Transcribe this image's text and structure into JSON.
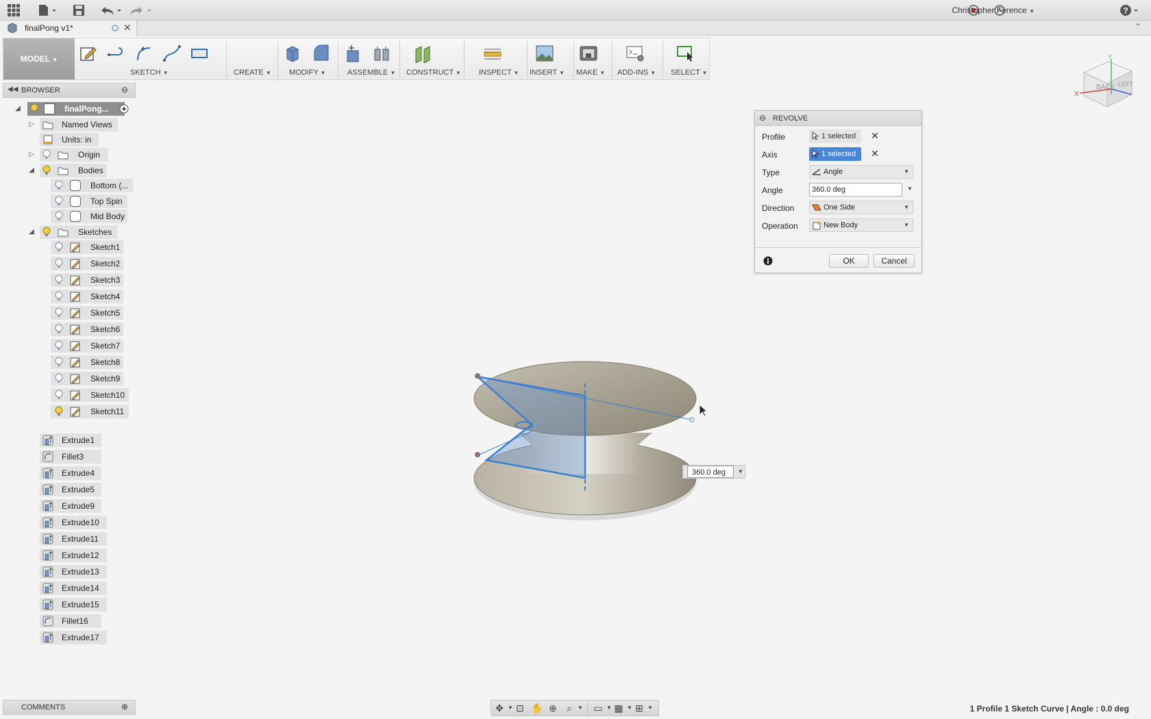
{
  "user": {
    "name": "Christopher Ference"
  },
  "document": {
    "tab_title": "finalPong v1*"
  },
  "ribbon": {
    "workspace": "MODEL",
    "groups": [
      "SKETCH",
      "CREATE",
      "MODIFY",
      "ASSEMBLE",
      "CONSTRUCT",
      "INSPECT",
      "INSERT",
      "MAKE",
      "ADD-INS",
      "SELECT"
    ]
  },
  "browser": {
    "title": "BROWSER",
    "root": "finalPong...",
    "named_views": "Named Views",
    "units": "Units: in",
    "origin": "Origin",
    "bodies": "Bodies",
    "body_items": [
      "Bottom (...",
      "Top Spin",
      "Mid Body"
    ],
    "sketches": "Sketches",
    "sketch_items": [
      "Sketch1",
      "Sketch2",
      "Sketch3",
      "Sketch4",
      "Sketch5",
      "Sketch6",
      "Sketch7",
      "Sketch8",
      "Sketch9",
      "Sketch10",
      "Sketch11"
    ],
    "features": [
      "Extrude1",
      "Fillet3",
      "Extrude4",
      "Extrude5",
      "Extrude9",
      "Extrude10",
      "Extrude11",
      "Extrude12",
      "Extrude13",
      "Extrude14",
      "Extrude15",
      "Fillet16",
      "Extrude17"
    ]
  },
  "comments": {
    "title": "COMMENTS"
  },
  "viewcube": {
    "back": "BACK",
    "left": "LEFT",
    "axis_x": "X",
    "axis_y": "Y"
  },
  "revolve": {
    "title": "REVOLVE",
    "profile_label": "Profile",
    "profile_value": "1 selected",
    "axis_label": "Axis",
    "axis_value": "1 selected",
    "type_label": "Type",
    "type_value": "Angle",
    "angle_label": "Angle",
    "angle_value": "360.0 deg",
    "direction_label": "Direction",
    "direction_value": "One Side",
    "operation_label": "Operation",
    "operation_value": "New Body",
    "ok": "OK",
    "cancel": "Cancel"
  },
  "viewport": {
    "angle_input": "360.0 deg"
  },
  "status": {
    "text": "1 Profile 1 Sketch Curve | Angle : 0.0 deg"
  },
  "colors": {
    "accent_blue": "#3c7fd0",
    "selected_blue": "#4a86d8",
    "body_tan": "#a8a294"
  }
}
